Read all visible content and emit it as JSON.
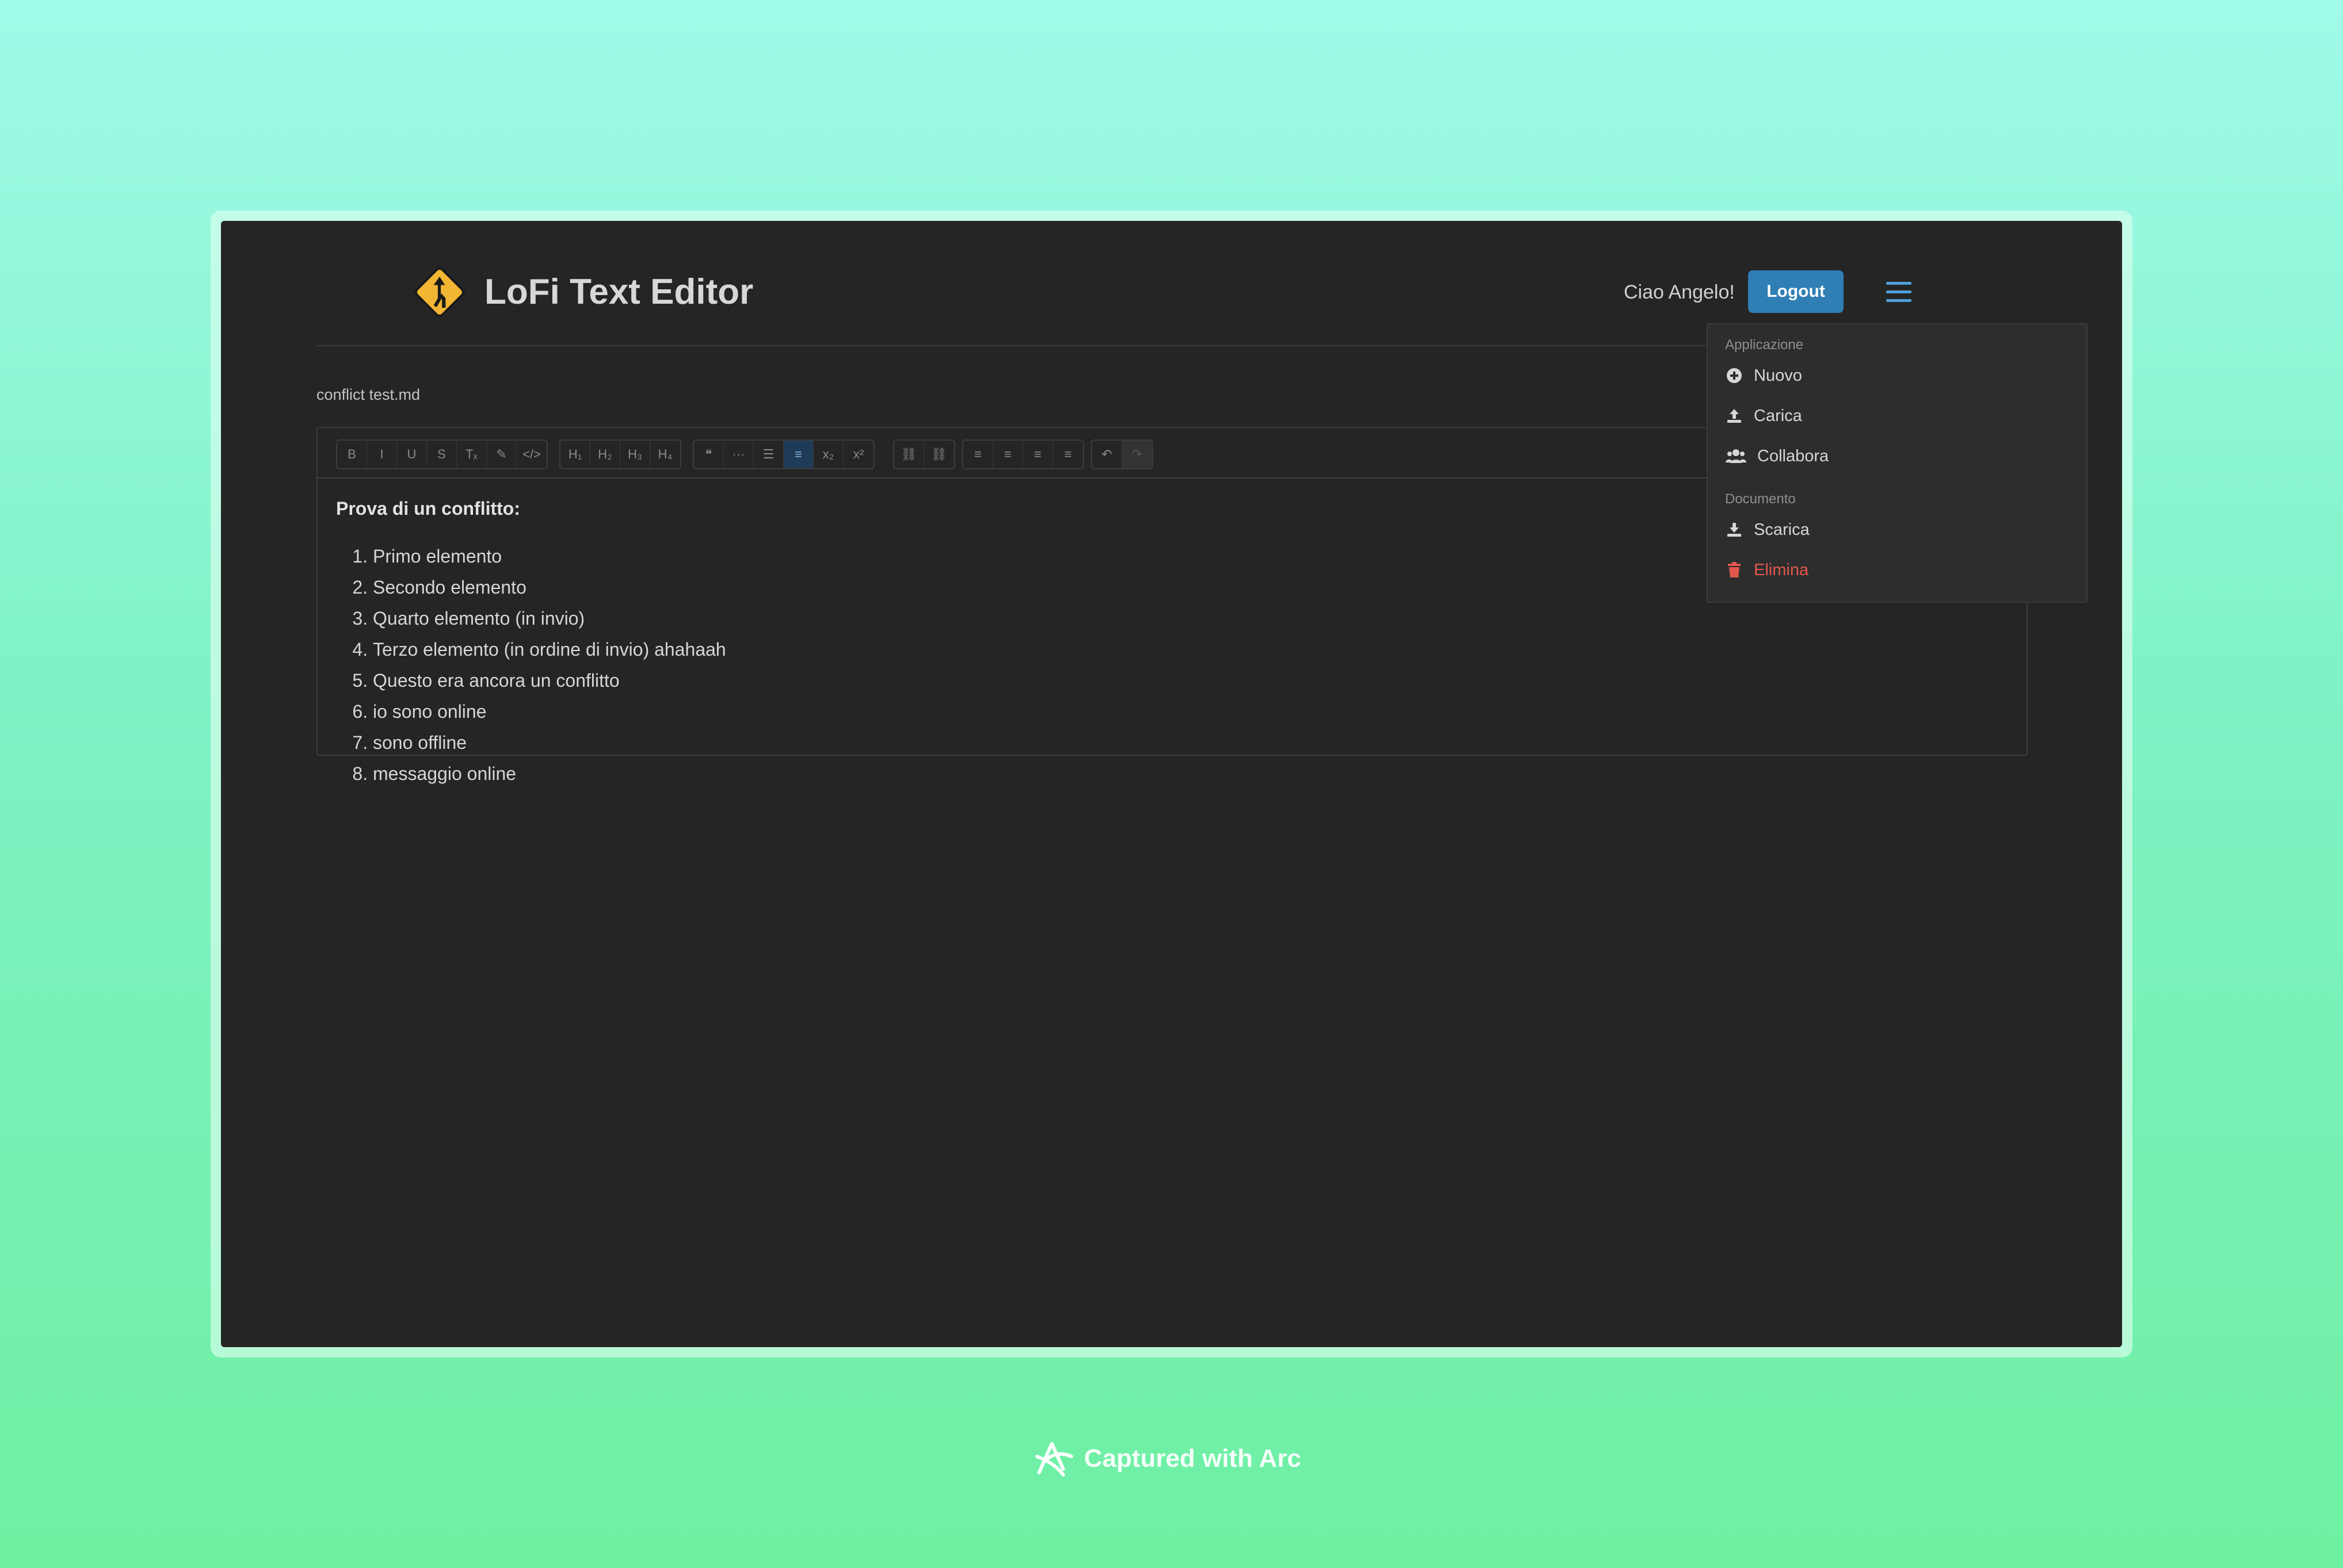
{
  "header": {
    "title": "LoFi Text Editor",
    "greeting": "Ciao Angelo!",
    "logout_label": "Logout",
    "logo_color": "#f2b632",
    "accent_color": "#2f7fb4"
  },
  "document": {
    "name": "conflict test.md"
  },
  "toolbar": {
    "groups": [
      [
        {
          "name": "bold",
          "label": "B",
          "icon": "bold-icon"
        },
        {
          "name": "italic",
          "label": "I",
          "icon": "italic-icon"
        },
        {
          "name": "underline",
          "label": "U",
          "icon": "underline-icon"
        },
        {
          "name": "strikethrough",
          "label": "S",
          "icon": "strikethrough-icon"
        },
        {
          "name": "clear-format",
          "label": "Tₓ",
          "icon": "clear-format-icon"
        },
        {
          "name": "highlight",
          "label": "✎",
          "icon": "highlight-icon"
        },
        {
          "name": "code",
          "label": "</>",
          "icon": "code-icon"
        }
      ],
      [
        {
          "name": "h1",
          "label": "H₁",
          "icon": "heading-1-icon"
        },
        {
          "name": "h2",
          "label": "H₂",
          "icon": "heading-2-icon"
        },
        {
          "name": "h3",
          "label": "H₃",
          "icon": "heading-3-icon"
        },
        {
          "name": "h4",
          "label": "H₄",
          "icon": "heading-4-icon"
        }
      ],
      [
        {
          "name": "blockquote",
          "label": "❝",
          "icon": "blockquote-icon"
        },
        {
          "name": "horizontal-rule",
          "label": "···",
          "icon": "horizontal-rule-icon"
        },
        {
          "name": "bullet-list",
          "label": "☰",
          "icon": "bullet-list-icon"
        },
        {
          "name": "ordered-list",
          "label": "≡",
          "icon": "ordered-list-icon",
          "active": true
        },
        {
          "name": "subscript",
          "label": "x₂",
          "icon": "subscript-icon"
        },
        {
          "name": "superscript",
          "label": "x²",
          "icon": "superscript-icon"
        }
      ],
      [
        {
          "name": "link",
          "label": "⛓",
          "icon": "link-icon"
        },
        {
          "name": "unlink",
          "label": "⛓",
          "icon": "unlink-icon"
        }
      ],
      [
        {
          "name": "align-left",
          "label": "≡",
          "icon": "align-left-icon"
        },
        {
          "name": "align-center",
          "label": "≡",
          "icon": "align-center-icon"
        },
        {
          "name": "align-justify",
          "label": "≡",
          "icon": "align-justify-icon"
        },
        {
          "name": "align-right",
          "label": "≡",
          "icon": "align-right-icon"
        }
      ],
      [
        {
          "name": "undo",
          "label": "↶",
          "icon": "undo-icon"
        },
        {
          "name": "redo",
          "label": "↷",
          "icon": "redo-icon",
          "disabled": true
        }
      ]
    ]
  },
  "content": {
    "heading": "Prova di un conflitto:",
    "items": [
      "Primo elemento",
      "Secondo elemento",
      "Quarto elemento (in invio)",
      "Terzo elemento (in ordine di invio) ahahaah",
      "Questo era ancora un conflitto",
      "io sono online",
      "sono offline",
      "messaggio online"
    ]
  },
  "menu": {
    "section_app": "Applicazione",
    "new_label": "Nuovo",
    "upload_label": "Carica",
    "collaborate_label": "Collabora",
    "section_doc": "Documento",
    "download_label": "Scarica",
    "delete_label": "Elimina",
    "danger_color": "#e2574c"
  },
  "footer": {
    "credit": "Captured with Arc"
  }
}
